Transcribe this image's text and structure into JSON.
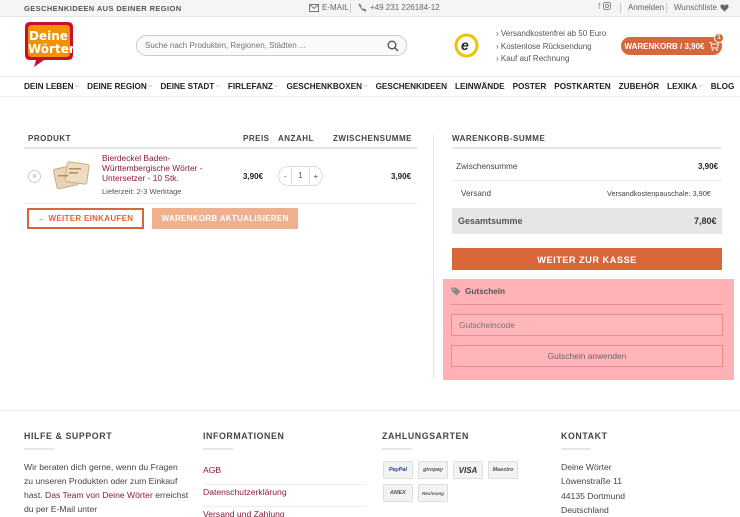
{
  "topbar": {
    "tagline": "GESCHENKIDEEN AUS DEINER REGION",
    "email": "E-MAIL",
    "phone": "+49 231 226184-12",
    "login": "Anmelden",
    "wishlist": "Wunschliste"
  },
  "header": {
    "logo_line1": "Deine",
    "logo_line2": "Wörter",
    "search_placeholder": "Suche nach Produkten, Regionen, Städten ...",
    "trust_badge": "e",
    "usp": [
      "Versandkostenfrei ab 50 Euro",
      "Kostenlose Rücksendung",
      "Kauf auf Rechnung"
    ],
    "cart_label": "WARENKORB / 3,90€",
    "cart_count": "1"
  },
  "nav": [
    {
      "label": "DEIN LEBEN",
      "chevron": true
    },
    {
      "label": "DEINE REGION",
      "chevron": true
    },
    {
      "label": "DEINE STADT",
      "chevron": true
    },
    {
      "label": "FIRLEFANZ",
      "chevron": true
    },
    {
      "label": "GESCHENKBOXEN",
      "chevron": true
    },
    {
      "label": "GESCHENKIDEEN",
      "chevron": false
    },
    {
      "label": "LEINWÄNDE",
      "chevron": false
    },
    {
      "label": "POSTER",
      "chevron": false
    },
    {
      "label": "POSTKARTEN",
      "chevron": false
    },
    {
      "label": "ZUBEHÖR",
      "chevron": false
    },
    {
      "label": "LEXIKA",
      "chevron": true
    },
    {
      "label": "BLOG",
      "chevron": false
    }
  ],
  "cart": {
    "headers": {
      "product": "PRODUKT",
      "price": "PREIS",
      "qty": "ANZAHL",
      "subtotal": "ZWISCHENSUMME"
    },
    "item": {
      "name": "Bierdeckel Baden-Württembergische Wörter - Untersetzer - 10 Stk.",
      "delivery": "Lieferzeit: 2-3 Werktage",
      "price": "3,90€",
      "qty": "1",
      "subtotal": "3,90€"
    },
    "remove": "×",
    "minus": "-",
    "plus": "+",
    "continue_label": "← WEITER EINKAUFEN",
    "update_label": "WARENKORB AKTUALISIEREN"
  },
  "totals": {
    "heading": "WARENKORB-SUMME",
    "subtotal_label": "Zwischensumme",
    "subtotal_value": "3,90€",
    "shipping_label": "Versand",
    "shipping_value": "Versandkostenpauschale: 3,90€",
    "total_label": "Gesamtsumme",
    "total_value": "7,80€",
    "checkout_label": "WEITER ZUR KASSE"
  },
  "coupon": {
    "title": "Gutschein",
    "placeholder": "Gutscheincode",
    "apply_label": "Gutschein anwenden"
  },
  "footer": {
    "help_heading": "HILFE & SUPPORT",
    "help_text_1": "Wir beraten dich gerne, wenn du Fragen zu unseren Produkten oder zum Einkauf hast. ",
    "help_link": "Das Team von Deine Wörter",
    "help_text_2": " erreichst du per E-Mail unter",
    "info_heading": "INFORMATIONEN",
    "info_links": [
      "AGB",
      "Datenschutzerklärung",
      "Versand und Zahlung"
    ],
    "pay_heading": "ZAHLUNGSARTEN",
    "pay_methods": [
      "PayPal",
      "giropay",
      "VISA",
      "Maestro",
      "AMEX",
      "Rechnung"
    ],
    "contact_heading": "KONTAKT",
    "contact_lines": [
      "Deine Wörter",
      "Löwenstraße 11",
      "44135 Dortmund",
      "Deutschland"
    ]
  },
  "colors": {
    "accent": "#d9653a",
    "brand_red": "#c8102e",
    "link": "#8b1a3c",
    "coupon_highlight": "#ffb1b6"
  }
}
